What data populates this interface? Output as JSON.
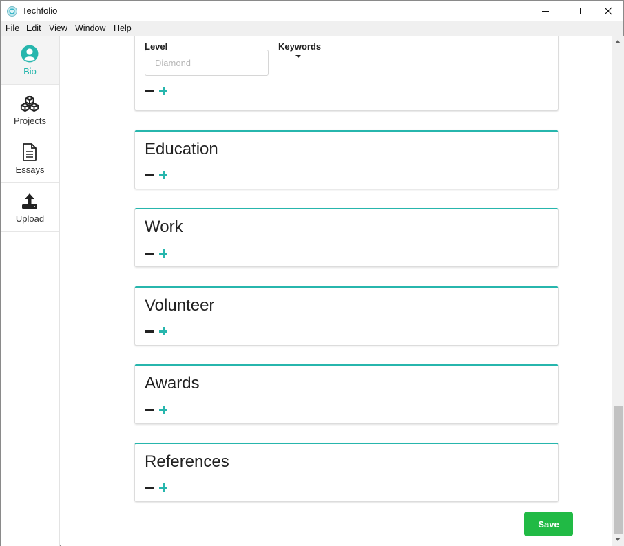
{
  "window": {
    "title": "Techfolio"
  },
  "menu": [
    "File",
    "Edit",
    "View",
    "Window",
    "Help"
  ],
  "sidebar": {
    "items": [
      {
        "label": "Bio",
        "icon": "user-circle-icon",
        "active": true
      },
      {
        "label": "Projects",
        "icon": "cubes-icon",
        "active": false
      },
      {
        "label": "Essays",
        "icon": "document-icon",
        "active": false
      },
      {
        "label": "Upload",
        "icon": "upload-icon",
        "active": false
      }
    ]
  },
  "skills_card": {
    "level_label": "Level",
    "level_placeholder": "Diamond",
    "keywords_label": "Keywords"
  },
  "sections": [
    {
      "title": "Education"
    },
    {
      "title": "Work"
    },
    {
      "title": "Volunteer"
    },
    {
      "title": "Awards"
    },
    {
      "title": "References"
    }
  ],
  "actions": {
    "save_label": "Save"
  },
  "colors": {
    "accent": "#27b6ad",
    "save": "#21ba45"
  }
}
